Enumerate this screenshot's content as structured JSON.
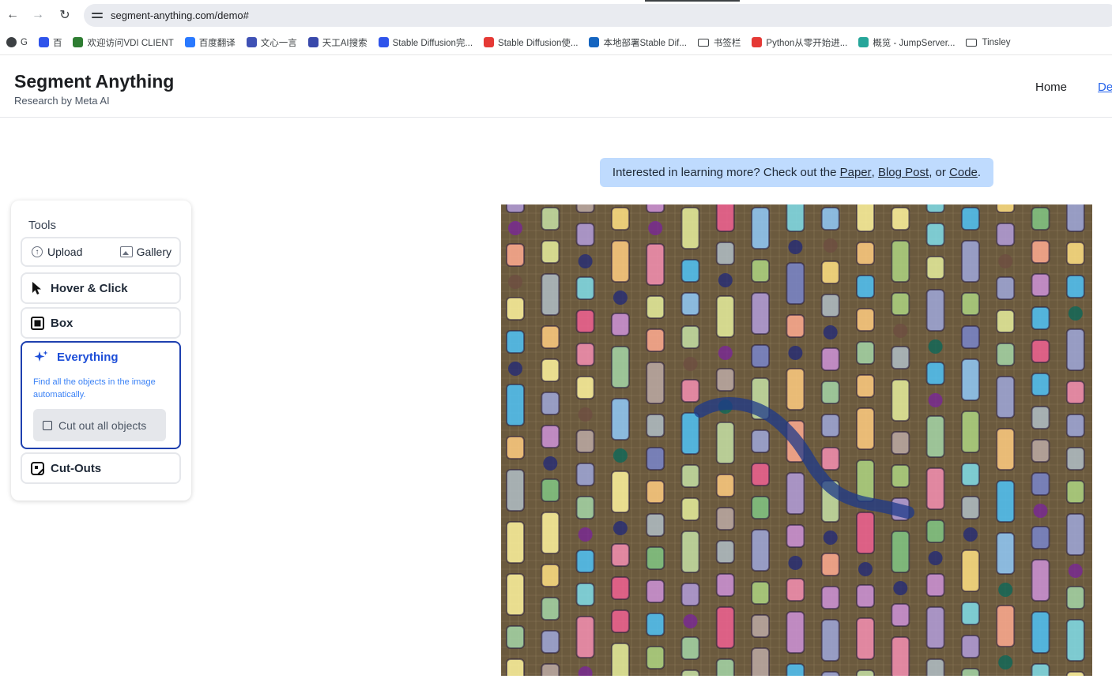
{
  "browser": {
    "url": "segment-anything.com/demo#",
    "bookmarks": [
      {
        "label": "G",
        "icon": "globe-icon",
        "color": "#3c4043"
      },
      {
        "label": "百",
        "icon": "paw-icon",
        "color": "#2f54eb"
      },
      {
        "label": "欢迎访问VDI CLIENT",
        "icon": "vdi-icon",
        "color": "#2e7d32"
      },
      {
        "label": "百度翻译",
        "icon": "translate-icon",
        "color": "#2979ff"
      },
      {
        "label": "文心一言",
        "icon": "wenxin-icon",
        "color": "#3f51b5"
      },
      {
        "label": "天工AI搜索",
        "icon": "tiangong-icon",
        "color": "#3949ab"
      },
      {
        "label": "Stable Diffusion完...",
        "icon": "paw-icon",
        "color": "#2f54eb"
      },
      {
        "label": "Stable Diffusion使...",
        "icon": "csdn-icon",
        "color": "#e53935"
      },
      {
        "label": "本地部署Stable Dif...",
        "icon": "zhihu-icon",
        "color": "#1565c0"
      },
      {
        "label": "书签栏",
        "icon": "folder-icon",
        "color": "#3c4043"
      },
      {
        "label": "Python从零开始进...",
        "icon": "csdn-icon",
        "color": "#e53935"
      },
      {
        "label": "概览 - JumpServer...",
        "icon": "jumpserver-icon",
        "color": "#26a69a"
      },
      {
        "label": "Tinsley",
        "icon": "folder-icon",
        "color": "#3c4043"
      }
    ]
  },
  "site": {
    "title": "Segment Anything",
    "subtitle": "Research by Meta AI",
    "nav_home": "Home",
    "nav_demo": "De"
  },
  "banner": {
    "prefix": "Interested in learning more? Check out the ",
    "paper": "Paper",
    "sep1": ", ",
    "blog": "Blog Post",
    "sep2": ", or ",
    "code": "Code",
    "suffix": "."
  },
  "tools": {
    "label": "Tools",
    "upload": "Upload",
    "gallery": "Gallery",
    "hover_click": "Hover & Click",
    "box": "Box",
    "everything": "Everything",
    "everything_desc": "Find all the objects in the image automatically.",
    "cut_all": "Cut out all objects",
    "cut_outs": "Cut-Outs"
  },
  "colors": {
    "accent": "#1d4ed8",
    "banner_bg": "#bfdbfe",
    "image_bg": "#6b5a3e",
    "stroke": "#1e3a8a"
  }
}
